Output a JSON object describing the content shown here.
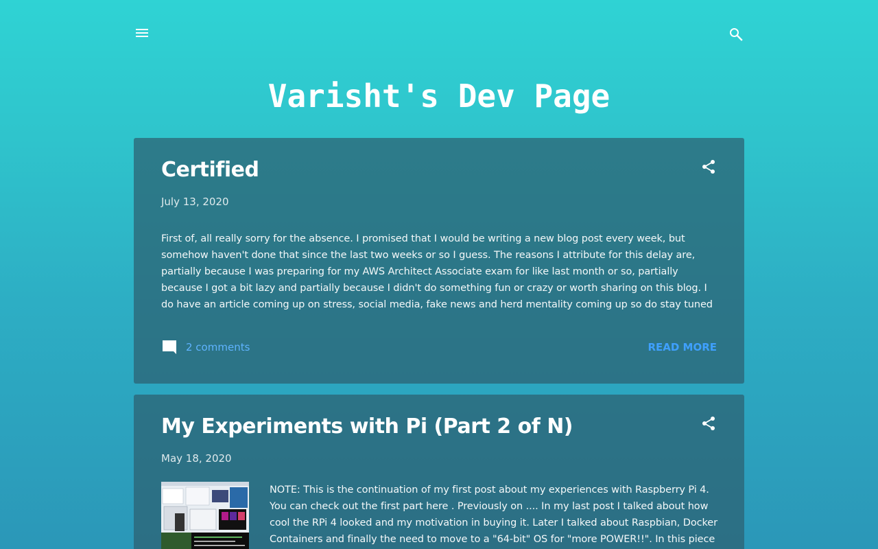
{
  "header": {
    "menu_icon": "hamburger-menu-icon",
    "search_icon": "search-icon",
    "site_title": "Varisht's Dev Page"
  },
  "posts": [
    {
      "title": "Certified",
      "date": "July 13, 2020",
      "snippet": "First of, all really sorry for the absence. I promised that I would be writing a new blog post every week, but somehow haven't done that since the last two weeks or so I guess. The reasons I attribute for this delay are, partially because I was preparing for my AWS Architect Associate exam for like last month or so, partially because I got a bit lazy and partially because I didn't do something fun or crazy or worth sharing on this blog. I do have an article coming up on stress, social media, fake news and herd mentality coming up so do stay tuned for that. Major blocker for that being that I am confused",
      "comments": "2 comments",
      "read_more": "READ MORE"
    },
    {
      "title": "My Experiments with Pi (Part 2 of N)",
      "date": "May 18, 2020",
      "snippet": "NOTE: This is the continuation of my first post about my experiences with Raspberry Pi 4. You can check out the first part here . Previously on .... In my last post I talked about how cool the RPi 4 looked and my motivation in buying it. Later I talked about Raspbian, Docker Containers and finally the need to move to a \"64-bit\" OS for \"more POWER!!\". In this piece I'll continue from there"
    }
  ],
  "colors": {
    "background_top": "#2fd3d4",
    "background_bottom": "#2b97b8",
    "card": "#2c6070",
    "link": "#5fb3ff",
    "read_more": "#3fa0ff"
  }
}
